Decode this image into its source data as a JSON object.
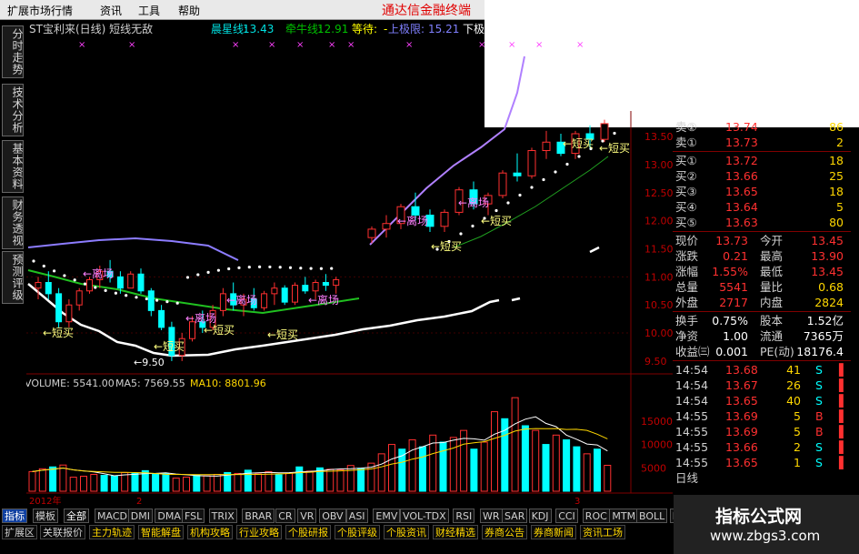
{
  "menu": {
    "items": [
      "扩展市场行情",
      "资讯",
      "工具",
      "帮助"
    ],
    "brand": "通达信金融终端"
  },
  "left_tabs": [
    "分时走势",
    "技术分析",
    "基本资料",
    "财务透视",
    "预测评级"
  ],
  "chart_header": {
    "name": "ST宝利来(日线) 短线无敌",
    "indicators": [
      {
        "label": "晨星线:",
        "value": "13.43",
        "color": "#00e0e0"
      },
      {
        "label": "牵牛线:",
        "value": "12.91",
        "color": "#00c000"
      },
      {
        "label": "等待:",
        "value": "-",
        "color": "#ffff00"
      },
      {
        "label": "上极限:",
        "value": "15.21",
        "color": "#8080ff"
      },
      {
        "label": "下极限",
        "value": "",
        "color": "#ffffff"
      }
    ]
  },
  "signals": {
    "buy": "←短买",
    "sell": "←离场"
  },
  "low_label": "←9.50",
  "y_axis": [
    "13.50",
    "13.00",
    "12.50",
    "12.00",
    "11.50",
    "11.00",
    "10.50",
    "10.00",
    "9.50"
  ],
  "volume_header": {
    "vol": "VOLUME: 5541.00",
    "ma5": "MA5: 7569.55",
    "ma10": "MA10: 8801.96"
  },
  "vol_axis": [
    "15000",
    "10000",
    "5000"
  ],
  "time_axis": [
    "2012年",
    "2",
    "3"
  ],
  "quotes": {
    "sell": [
      {
        "label": "卖②",
        "price": "13.74",
        "vol": "86"
      },
      {
        "label": "卖①",
        "price": "13.73",
        "vol": "2"
      }
    ],
    "buy": [
      {
        "label": "买①",
        "price": "13.72",
        "vol": "18"
      },
      {
        "label": "买②",
        "price": "13.66",
        "vol": "25"
      },
      {
        "label": "买③",
        "price": "13.65",
        "vol": "18"
      },
      {
        "label": "买④",
        "price": "13.64",
        "vol": "5"
      },
      {
        "label": "买⑤",
        "price": "13.63",
        "vol": "80"
      }
    ],
    "stats": [
      {
        "l1": "现价",
        "v1": "13.73",
        "l2": "今开",
        "v2": "13.45"
      },
      {
        "l1": "涨跌",
        "v1": "0.21",
        "l2": "最高",
        "v2": "13.90"
      },
      {
        "l1": "涨幅",
        "v1": "1.55%",
        "l2": "最低",
        "v2": "13.45"
      },
      {
        "l1": "总量",
        "v1": "5541",
        "l2": "量比",
        "v2": "0.68"
      },
      {
        "l1": "外盘",
        "v1": "2717",
        "l2": "内盘",
        "v2": "2824"
      }
    ],
    "stats2": [
      {
        "l1": "换手",
        "v1": "0.75%",
        "l2": "股本",
        "v2": "1.52亿"
      },
      {
        "l1": "净资",
        "v1": "1.00",
        "l2": "流通",
        "v2": "7365万"
      },
      {
        "l1": "收益㈢",
        "v1": "0.001",
        "l2": "PE(动)",
        "v2": "18176.4"
      }
    ],
    "ticks": [
      {
        "time": "14:54",
        "price": "13.68",
        "vol": "41",
        "side": "S"
      },
      {
        "time": "14:54",
        "price": "13.67",
        "vol": "26",
        "side": "S"
      },
      {
        "time": "14:54",
        "price": "13.65",
        "vol": "40",
        "side": "S"
      },
      {
        "time": "14:55",
        "price": "13.69",
        "vol": "5",
        "side": "B"
      },
      {
        "time": "14:55",
        "price": "13.69",
        "vol": "5",
        "side": "B"
      },
      {
        "time": "14:55",
        "price": "13.66",
        "vol": "2",
        "side": "S"
      },
      {
        "time": "14:55",
        "price": "13.65",
        "vol": "1",
        "side": "S"
      }
    ],
    "period": "日线"
  },
  "indicator_tabs": [
    "指标",
    "模板",
    "全部",
    "MACD",
    "DMI",
    "DMA",
    "FSL",
    "TRIX",
    "BRAR",
    "CR",
    "VR",
    "OBV",
    "ASI",
    "EMV",
    "VOL-TDX",
    "RSI",
    "WR",
    "SAR",
    "KDJ",
    "CCI",
    "ROC",
    "MTM",
    "BOLL",
    "PSY"
  ],
  "nav_tabs": [
    "扩展区",
    "关联报价",
    "主力轨迹",
    "智能解盘",
    "机构攻略",
    "行业攻略",
    "个股研报",
    "个股评级",
    "个股资讯",
    "财经精选",
    "券商公告",
    "券商新闻",
    "资讯工场"
  ],
  "watermark": {
    "title": "指标公式网",
    "url": "www.zbgs3.com"
  },
  "colors": {
    "up": "#ff3030",
    "down": "#00ffff",
    "bg": "#000000",
    "grid": "#800000"
  },
  "chart_data": {
    "type": "candlestick",
    "x_range": "2012-01 to 2012-03",
    "ylim": [
      9.4,
      13.6
    ],
    "candles": [
      {
        "o": 10.8,
        "h": 11.0,
        "l": 10.6,
        "c": 10.9
      },
      {
        "o": 10.9,
        "h": 11.1,
        "l": 10.6,
        "c": 10.7
      },
      {
        "o": 10.7,
        "h": 10.8,
        "l": 10.1,
        "c": 10.2
      },
      {
        "o": 10.2,
        "h": 10.6,
        "l": 10.1,
        "c": 10.5
      },
      {
        "o": 10.5,
        "h": 10.8,
        "l": 10.4,
        "c": 10.75
      },
      {
        "o": 10.75,
        "h": 11.0,
        "l": 10.7,
        "c": 10.95
      },
      {
        "o": 10.95,
        "h": 11.2,
        "l": 10.8,
        "c": 11.1
      },
      {
        "o": 11.1,
        "h": 11.3,
        "l": 10.9,
        "c": 11.0
      },
      {
        "o": 11.0,
        "h": 11.1,
        "l": 10.7,
        "c": 10.8
      },
      {
        "o": 10.8,
        "h": 11.1,
        "l": 10.8,
        "c": 11.05
      },
      {
        "o": 11.05,
        "h": 11.15,
        "l": 10.7,
        "c": 10.75
      },
      {
        "o": 10.75,
        "h": 10.8,
        "l": 10.3,
        "c": 10.4
      },
      {
        "o": 10.4,
        "h": 10.5,
        "l": 10.05,
        "c": 10.1
      },
      {
        "o": 10.1,
        "h": 10.2,
        "l": 9.5,
        "c": 9.6
      },
      {
        "o": 9.6,
        "h": 10.0,
        "l": 9.5,
        "c": 9.9
      },
      {
        "o": 9.9,
        "h": 10.3,
        "l": 9.85,
        "c": 10.2
      },
      {
        "o": 10.2,
        "h": 10.4,
        "l": 10.0,
        "c": 10.1
      },
      {
        "o": 10.1,
        "h": 10.5,
        "l": 10.05,
        "c": 10.4
      },
      {
        "o": 10.4,
        "h": 10.8,
        "l": 10.3,
        "c": 10.7
      },
      {
        "o": 10.7,
        "h": 10.9,
        "l": 10.4,
        "c": 10.5
      },
      {
        "o": 10.5,
        "h": 10.7,
        "l": 10.3,
        "c": 10.6
      },
      {
        "o": 10.6,
        "h": 10.8,
        "l": 10.4,
        "c": 10.45
      },
      {
        "o": 10.45,
        "h": 10.75,
        "l": 10.4,
        "c": 10.7
      },
      {
        "o": 10.7,
        "h": 10.9,
        "l": 10.5,
        "c": 10.8
      },
      {
        "o": 10.8,
        "h": 10.85,
        "l": 10.5,
        "c": 10.55
      },
      {
        "o": 10.55,
        "h": 10.9,
        "l": 10.5,
        "c": 10.85
      },
      {
        "o": 10.85,
        "h": 11.0,
        "l": 10.7,
        "c": 10.75
      },
      {
        "o": 10.75,
        "h": 10.95,
        "l": 10.6,
        "c": 10.9
      },
      {
        "o": 10.9,
        "h": 11.05,
        "l": 10.75,
        "c": 10.85
      },
      {
        "o": 10.85,
        "h": 11.0,
        "l": 10.7,
        "c": 10.95
      }
    ],
    "candles_right": [
      {
        "o": 11.7,
        "h": 11.9,
        "l": 11.6,
        "c": 11.85
      },
      {
        "o": 11.85,
        "h": 12.1,
        "l": 11.7,
        "c": 11.95
      },
      {
        "o": 11.95,
        "h": 12.3,
        "l": 11.85,
        "c": 12.25
      },
      {
        "o": 12.25,
        "h": 12.5,
        "l": 12.0,
        "c": 12.1
      },
      {
        "o": 12.1,
        "h": 12.2,
        "l": 11.8,
        "c": 11.9
      },
      {
        "o": 11.9,
        "h": 12.2,
        "l": 11.8,
        "c": 12.15
      },
      {
        "o": 12.15,
        "h": 12.6,
        "l": 12.1,
        "c": 12.55
      },
      {
        "o": 12.55,
        "h": 12.7,
        "l": 12.2,
        "c": 12.3
      },
      {
        "o": 12.3,
        "h": 12.5,
        "l": 12.1,
        "c": 12.45
      },
      {
        "o": 12.45,
        "h": 12.9,
        "l": 12.4,
        "c": 12.85
      },
      {
        "o": 12.85,
        "h": 13.2,
        "l": 12.7,
        "c": 12.8
      },
      {
        "o": 12.8,
        "h": 13.3,
        "l": 12.75,
        "c": 13.25
      },
      {
        "o": 13.25,
        "h": 13.6,
        "l": 13.1,
        "c": 13.4
      },
      {
        "o": 13.4,
        "h": 13.55,
        "l": 13.15,
        "c": 13.2
      },
      {
        "o": 13.2,
        "h": 13.6,
        "l": 13.1,
        "c": 13.55
      },
      {
        "o": 13.55,
        "h": 13.7,
        "l": 13.3,
        "c": 13.45
      },
      {
        "o": 13.45,
        "h": 13.8,
        "l": 13.4,
        "c": 13.73
      }
    ],
    "volumes": [
      4200,
      4800,
      5200,
      5600,
      3000,
      3200,
      3600,
      3400,
      3300,
      4000,
      3800,
      4400,
      3600,
      3800,
      2800,
      3000,
      3400,
      3300,
      3600,
      4000,
      3800,
      4500,
      3700,
      4200,
      3500,
      3900,
      5200,
      4300,
      5000,
      4700,
      4600,
      5500,
      4900,
      6000,
      8000,
      10000,
      9000,
      11000,
      9500,
      12000,
      10500,
      11500,
      13000,
      9000,
      10500,
      17000,
      15500,
      20000,
      14000,
      13000,
      10000,
      12000,
      11000,
      9500,
      8000,
      9000,
      5541
    ],
    "vol_up": [
      1,
      1,
      0,
      1,
      1,
      1,
      1,
      0,
      0,
      1,
      0,
      0,
      0,
      0,
      1,
      1,
      0,
      1,
      1,
      0,
      1,
      0,
      1,
      1,
      0,
      1,
      0,
      1,
      0,
      1,
      1,
      1,
      0,
      1,
      1,
      1,
      0,
      1,
      0,
      1,
      0,
      1,
      1,
      0,
      1,
      1,
      0,
      1,
      0,
      1,
      0,
      1,
      0,
      0,
      1,
      0,
      1
    ],
    "ylim_vol": [
      0,
      21000
    ]
  }
}
